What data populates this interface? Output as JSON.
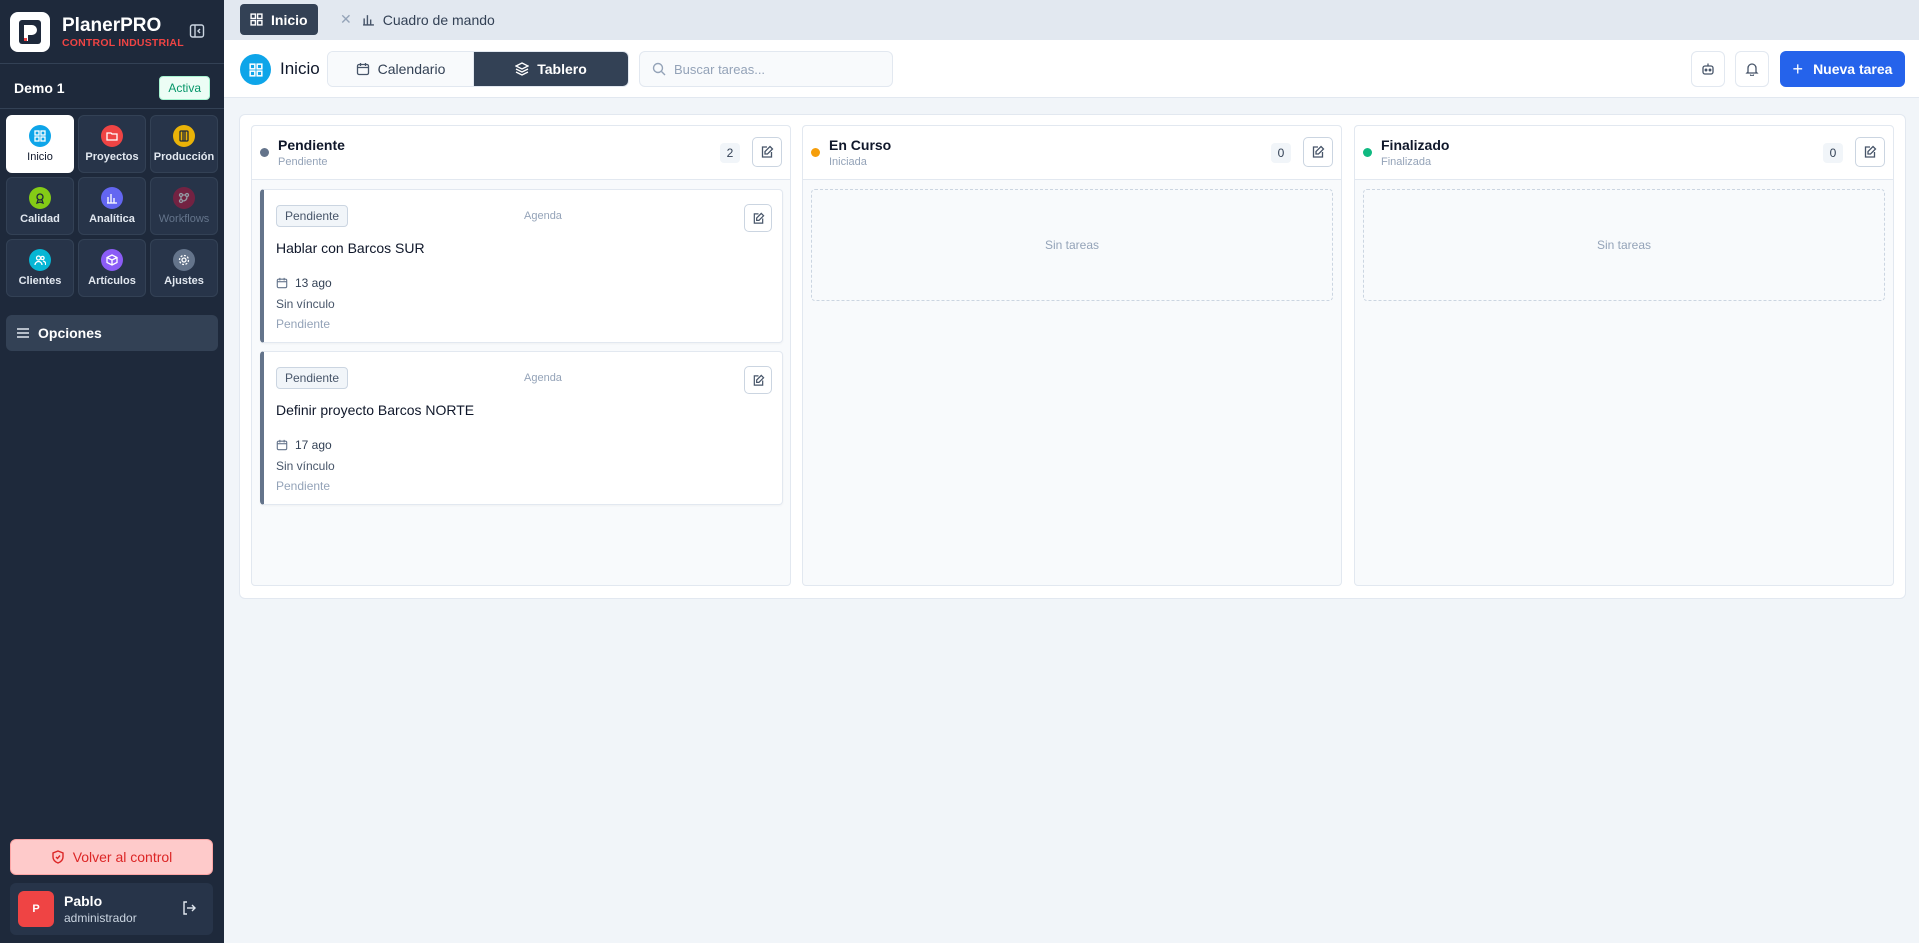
{
  "brand": {
    "name": "PlanerPRO",
    "subtitle": "CONTROL INDUSTRIAL"
  },
  "workspace": {
    "name": "Demo 1",
    "status": "Activa"
  },
  "modules": [
    {
      "label": "Inicio",
      "icon": "grid-icon",
      "color": "#0ea5e9"
    },
    {
      "label": "Proyectos",
      "icon": "folder-icon",
      "color": "#ef4444"
    },
    {
      "label": "Producción",
      "icon": "factory-icon",
      "color": "#eab308"
    },
    {
      "label": "Calidad",
      "icon": "badge-check-icon",
      "color": "#84cc16"
    },
    {
      "label": "Analítica",
      "icon": "bar-chart-icon",
      "color": "#6366f1"
    },
    {
      "label": "Workflows",
      "icon": "workflow-icon",
      "color": "#be123c"
    },
    {
      "label": "Clientes",
      "icon": "users-icon",
      "color": "#06b6d4"
    },
    {
      "label": "Artículos",
      "icon": "box-icon",
      "color": "#8b5cf6"
    },
    {
      "label": "Ajustes",
      "icon": "gear-icon",
      "color": "#64748b"
    }
  ],
  "sidebar": {
    "options_label": "Opciones",
    "back_label": "Volver al control"
  },
  "user": {
    "initial": "P",
    "name": "Pablo",
    "role": "administrador"
  },
  "tabs": [
    {
      "label": "Inicio",
      "active": true
    },
    {
      "label": "Cuadro de mando",
      "active": false
    }
  ],
  "header": {
    "title": "Inicio",
    "view_calendar": "Calendario",
    "view_board": "Tablero",
    "search_placeholder": "Buscar tareas...",
    "new_task": "Nueva tarea"
  },
  "columns": [
    {
      "title": "Pendiente",
      "subtitle": "Pendiente",
      "count": "2",
      "color": "#64748b"
    },
    {
      "title": "En Curso",
      "subtitle": "Iniciada",
      "count": "0",
      "color": "#f59e0b",
      "empty": "Sin tareas"
    },
    {
      "title": "Finalizado",
      "subtitle": "Finalizada",
      "count": "0",
      "color": "#10b981",
      "empty": "Sin tareas"
    }
  ],
  "tasks": [
    {
      "badge": "Pendiente",
      "type": "Agenda",
      "title": "Hablar con Barcos SUR",
      "date": "13 ago",
      "link": "Sin vínculo",
      "status": "Pendiente"
    },
    {
      "badge": "Pendiente",
      "type": "Agenda",
      "title": "Definir proyecto Barcos NORTE",
      "date": "17 ago",
      "link": "Sin vínculo",
      "status": "Pendiente"
    }
  ]
}
